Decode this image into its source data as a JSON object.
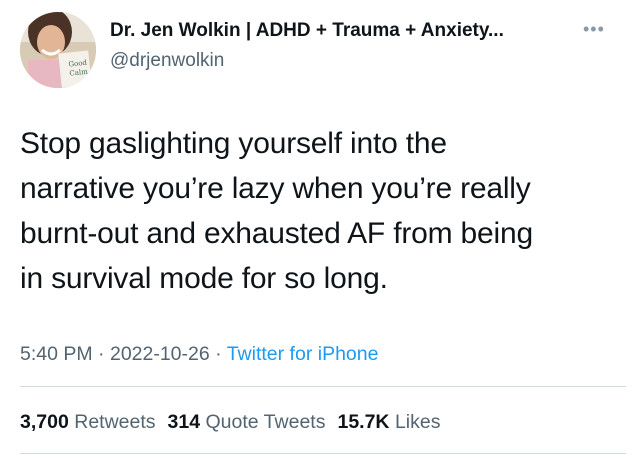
{
  "author": {
    "name": "Dr. Jen Wolkin | ADHD + Trauma + Anxiety...",
    "handle": "@drjenwolkin",
    "avatar_sign_text": "Good Calm"
  },
  "more_icon": "more-horizontal-icon",
  "tweet": {
    "lines": [
      "Stop gaslighting yourself into the",
      "narrative you’re lazy when you’re really",
      "burnt-out and exhausted AF from being",
      "in survival mode for so long."
    ]
  },
  "meta": {
    "time": "5:40 PM",
    "separator": "·",
    "date": "2022-10-26",
    "source": "Twitter for iPhone"
  },
  "stats": {
    "retweets_count": "3,700",
    "retweets_label": "Retweets",
    "quotes_count": "314",
    "quotes_label": "Quote Tweets",
    "likes_count": "15.7K",
    "likes_label": "Likes"
  },
  "colors": {
    "text": "#0f1419",
    "secondary": "#536471",
    "link": "#1d9bf0",
    "divider": "#cfd9de"
  }
}
